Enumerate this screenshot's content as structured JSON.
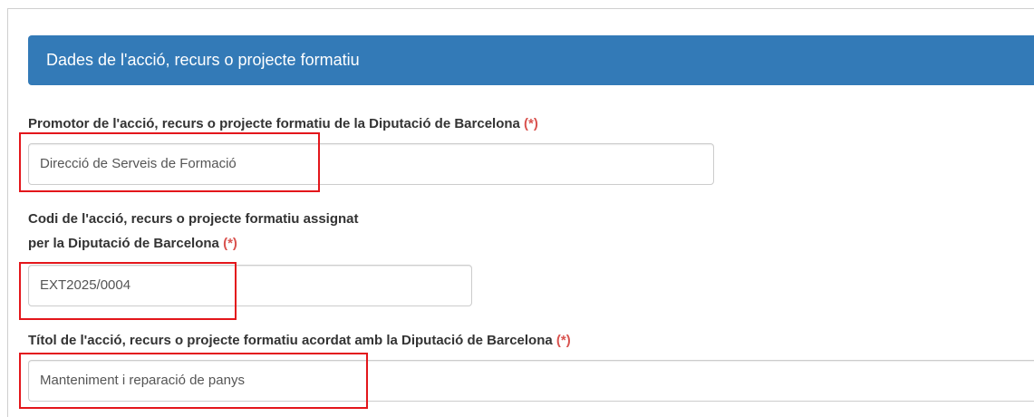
{
  "panel": {
    "title": "Dades de l'acció, recurs o projecte formatiu"
  },
  "fields": {
    "promotor": {
      "label": "Promotor de l'acció, recurs o projecte formatiu de la Diputació de Barcelona",
      "required_mark": "(*)",
      "value": "Direcció de Serveis de Formació"
    },
    "codi": {
      "label_line1": "Codi de l'acció, recurs o projecte formatiu assignat",
      "label_line2": "per la Diputació de Barcelona",
      "required_mark": "(*)",
      "value": "EXT2025/0004"
    },
    "titol": {
      "label": "Títol de l'acció, recurs o projecte formatiu acordat amb la Diputació de Barcelona",
      "required_mark": "(*)",
      "value": "Manteniment i reparació de panys"
    }
  },
  "colors": {
    "panel_heading": "#337ab7",
    "required_mark": "#d9534f",
    "highlight_box": "#e3161b"
  }
}
